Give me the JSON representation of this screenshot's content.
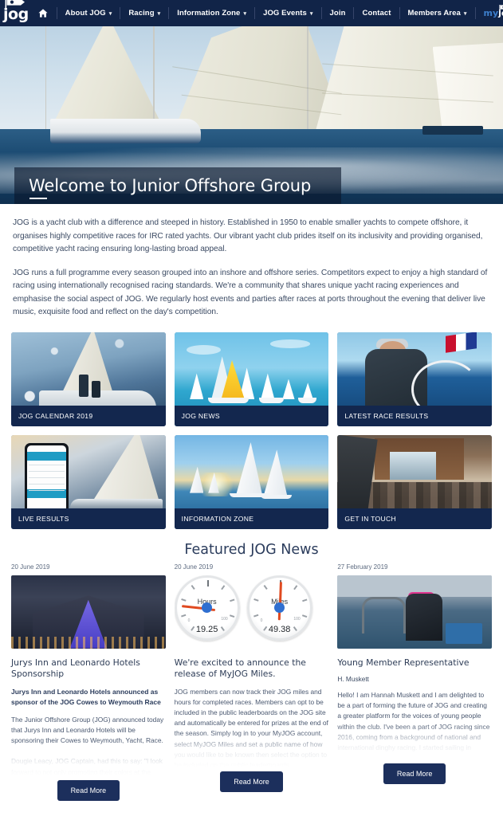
{
  "site": {
    "brand_name": "jog",
    "brand_icon": "flag-logo-icon"
  },
  "nav": {
    "home_icon": "home-icon",
    "items": [
      {
        "label": "About JOG",
        "has_caret": true
      },
      {
        "label": "Racing",
        "has_caret": true
      },
      {
        "label": "Information Zone",
        "has_caret": true
      },
      {
        "label": "JOG Events",
        "has_caret": true
      },
      {
        "label": "Join",
        "has_caret": false
      },
      {
        "label": "Contact",
        "has_caret": false
      },
      {
        "label": "Members Area",
        "has_caret": true
      }
    ],
    "myjog": {
      "prefix": "my",
      "suffix": "jog",
      "caret": "▾"
    },
    "caret": "▾",
    "colors": {
      "bar": "#112448",
      "my_accent": "#3d7fcc"
    }
  },
  "hero": {
    "title": "Welcome to Junior Offshore Group",
    "image_alt": "racing-yachts-hero-image"
  },
  "intro": {
    "paragraph1": "JOG is a yacht club with a difference and steeped in history. Established in 1950 to enable smaller yachts to compete offshore, it organises highly competitive races for IRC rated yachts. Our vibrant yacht club prides itself on its inclusivity and providing organised, competitive yacht racing ensuring long-lasting broad appeal.",
    "paragraph2": "JOG runs a full programme every season grouped into an inshore and offshore series. Competitors expect to enjoy a high standard of racing using internationally recognised racing standards. We're a community that shares unique yacht racing experiences and emphasise the social aspect of JOG. We regularly host events and parties after races at ports throughout the evening that deliver live music, exquisite food and reflect on the day's competition."
  },
  "tiles": [
    {
      "label": "JOG CALENDAR 2019",
      "image_alt": "yacht-crew-spray-photo"
    },
    {
      "label": "JOG NEWS",
      "image_alt": "fleet-racing-photo"
    },
    {
      "label": "LATEST RACE RESULTS",
      "image_alt": "helmsman-at-wheel-photo"
    },
    {
      "label": "LIVE RESULTS",
      "image_alt": "mobile-app-results-photo"
    },
    {
      "label": "INFORMATION ZONE",
      "image_alt": "yachts-at-sunset-photo"
    },
    {
      "label": "GET IN TOUCH",
      "image_alt": "members-social-gathering-photo"
    }
  ],
  "featured": {
    "heading": "Featured JOG News",
    "read_more_label": "Read More",
    "articles": [
      {
        "date": "20 June 2019",
        "image_alt": "jurys-inn-hotel-night-photo",
        "title": "Jurys Inn and Leonardo Hotels Sponsorship",
        "subtitle": "Jurys Inn and Leonardo Hotels announced as sponsor of the JOG Cowes to Weymouth Race",
        "body": "The Junior Offshore Group (JOG) announced today that Jurys Inn and Leonardo Hotels will be sponsoring their Cowes to Weymouth, Yacht, Race.\n\nDougie Leacy, JOG Captain, had this to say: \"I look forward to not only promoting their colors at the"
      },
      {
        "date": "20 June 2019",
        "image_alt": "myjog-miles-gauges-graphic",
        "title": "We're excited to announce the release of MyJOG Miles.",
        "body": "JOG members can now track their JOG miles and hours for completed races. Members can opt to be included in the public leaderboards on the JOG site and automatically be entered for prizes at the end of the season. Simply log in to your MyJOG account, select MyJOG Miles and set a public name of how you would like to be known then select the option to be included on the public leaderboards."
      },
      {
        "date": "27 February 2019",
        "image_alt": "young-sailor-at-helm-photo",
        "title": "Young Member Representative",
        "author": "H. Muskett",
        "body": "Hello! I am Hannah Muskett and I am delighted to be a part of forming the future of JOG and creating a greater platform for the voices of young people within the club. I've been a part of JOG racing since 2016, coming from a background of national and international dinghy racing. I started sailing in"
      }
    ]
  },
  "gauges": [
    {
      "label": "Hours",
      "value": "19.25",
      "min": "0",
      "max": "100",
      "needle_angle": 186
    },
    {
      "label": "Miles",
      "value": "49.38",
      "min": "0",
      "max": "100",
      "needle_angle": 272
    }
  ]
}
